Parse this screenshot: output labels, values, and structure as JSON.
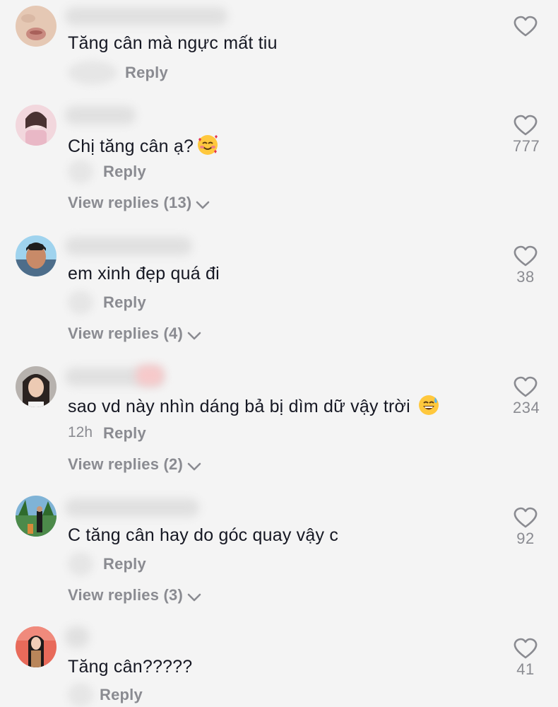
{
  "comments": [
    {
      "text": "Tăng cân mà ngực mất tiu",
      "time": "",
      "reply_label": "Reply",
      "likes": "",
      "view_replies": "",
      "emoji": ""
    },
    {
      "text": "Chị tăng cân ạ?",
      "time": "",
      "reply_label": "Reply",
      "likes": "777",
      "view_replies": "View replies (13)",
      "emoji": "smiling-face-with-hearts"
    },
    {
      "text": "em xinh đẹp quá đi",
      "time": "",
      "reply_label": "Reply",
      "likes": "38",
      "view_replies": "View replies (4)",
      "emoji": ""
    },
    {
      "text": "sao vd này nhìn dáng bả bị dìm dữ vậy trời",
      "time": "12h",
      "reply_label": "Reply",
      "likes": "234",
      "view_replies": "View replies (2)",
      "emoji": "grinning-face-with-sweat"
    },
    {
      "text": "C tăng cân hay do góc quay vậy c",
      "time": "",
      "reply_label": "Reply",
      "likes": "92",
      "view_replies": "View replies (3)",
      "emoji": ""
    },
    {
      "text": "Tăng cân?????",
      "time": "",
      "reply_label": "Reply",
      "likes": "41",
      "view_replies": "",
      "emoji": ""
    }
  ],
  "colors": {
    "background": "#f4f4f4",
    "text": "#161823",
    "secondary": "#8a8b91"
  }
}
